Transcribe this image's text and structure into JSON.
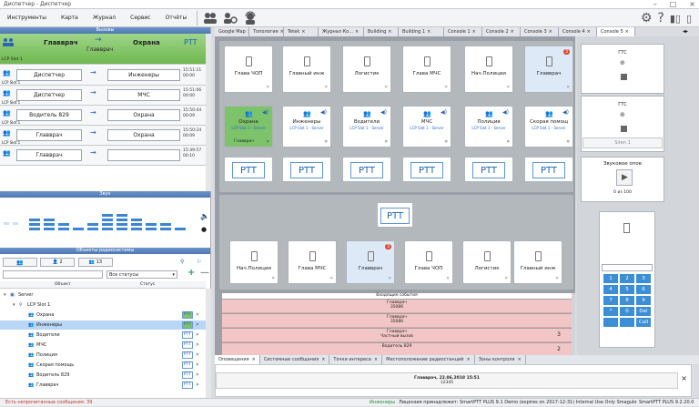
{
  "window": {
    "title": "Диспетчер - Диспетчер",
    "controls": [
      "–",
      "□",
      "×"
    ]
  },
  "menu": {
    "items": [
      "Инструменты",
      "Карта",
      "Журнал",
      "Сервис",
      "Отчёты"
    ]
  },
  "toolbar": {
    "icons": [
      "people-icon",
      "people-settings-icon",
      "operator-icon"
    ],
    "right_icons": [
      "gear-icon",
      "help-icon",
      "layout-icon",
      "panel-icon"
    ]
  },
  "calls_panel": {
    "title": "Вызовы",
    "active": {
      "from": "Главврач",
      "to": "Охрана",
      "via": "Главврач",
      "ptt": "PTT",
      "slot": "LCP Slot 1"
    },
    "rows": [
      {
        "from": "Диспетчер",
        "to": "Инженеры",
        "time": "15:51:11",
        "dur": "00:00",
        "slot": "LCP Slot 1"
      },
      {
        "from": "Диспетчер",
        "to": "МЧС",
        "time": "15:51:06",
        "dur": "00:00",
        "slot": "LCP Slot 1"
      },
      {
        "from": "Водитель 829",
        "to": "Охрана",
        "time": "15:50:44",
        "dur": "00:09",
        "slot": "LCP Slot 1"
      },
      {
        "from": "Главврач",
        "to": "Охрана",
        "time": "15:50:24",
        "dur": "00:09",
        "slot": "LCP Slot 1"
      },
      {
        "from": "Главврач",
        "to": "",
        "time": "15:49:57",
        "dur": "00:10",
        "slot": ""
      }
    ]
  },
  "sound_panel": {
    "title": "Звук"
  },
  "objects_panel": {
    "title": "Объекты радиосистемы",
    "tabs": [
      "",
      "2",
      "13"
    ],
    "filter": "Все статусы",
    "col_object": "Объект",
    "col_status": "Статус",
    "tree": [
      {
        "label": "Server",
        "indent": 0,
        "ptt": false
      },
      {
        "label": "LCP Slot 1",
        "indent": 1,
        "ptt": false
      },
      {
        "label": "Охрана",
        "indent": 2,
        "ptt": true,
        "hl": false,
        "green": true
      },
      {
        "label": "Инженеры",
        "indent": 2,
        "ptt": true,
        "hl": true,
        "green": true
      },
      {
        "label": "Водители",
        "indent": 2,
        "ptt": true,
        "hl": false,
        "green": false
      },
      {
        "label": "МЧС",
        "indent": 2,
        "ptt": true,
        "hl": false,
        "green": false
      },
      {
        "label": "Полиция",
        "indent": 2,
        "ptt": true,
        "hl": false,
        "green": false
      },
      {
        "label": "Скорая помощь",
        "indent": 2,
        "ptt": true,
        "hl": false,
        "green": false
      },
      {
        "label": "Водитель 829",
        "indent": 2,
        "ptt": true,
        "hl": false,
        "green": false
      },
      {
        "label": "Главврач",
        "indent": 2,
        "ptt": true,
        "hl": false,
        "green": false
      }
    ],
    "ptt_label": "PTT"
  },
  "tabs": [
    "Google Map",
    "Топология",
    "Tetek",
    "Журнал Ко...",
    "Building",
    "Building 1",
    "Console 1",
    "Console 2",
    "Console 3",
    "Console 4",
    "Console 5"
  ],
  "console": {
    "top_cards": [
      "Глава ЧОП",
      "Главный инж",
      "Логистик",
      "Глава МЧС",
      "Нач.Полиции",
      "Главврач"
    ],
    "badge": "3",
    "groups": [
      {
        "label": "Охрана",
        "sub": "LCP Slot 1 - Server",
        "active": true,
        "foot": "Главврач"
      },
      {
        "label": "Инженеры",
        "sub": "LCP Slot 1 - Server"
      },
      {
        "label": "Водители",
        "sub": "LCP Slot 1 - Server"
      },
      {
        "label": "МЧС",
        "sub": "LCP Slot 1 - Server"
      },
      {
        "label": "Полиция",
        "sub": "LCP Slot 1 - Server"
      },
      {
        "label": "Скорая помощ",
        "sub": "LCP Slot 1 - Server"
      }
    ],
    "ptt": "PTT",
    "bottom_cards": [
      "Нач.Полиции",
      "Глава МЧС",
      "Главврач",
      "Глава ЧОП",
      "Логистик",
      "Главный инж"
    ],
    "events_title": "Входящие события",
    "events": [
      {
        "a": "Главврач",
        "b": "35086",
        "n": ""
      },
      {
        "a": "Главврач",
        "b": "35086",
        "n": ""
      },
      {
        "a": "Главврач",
        "b": "Частный вызов",
        "n": "3"
      },
      {
        "a": "Водитель 829",
        "b": "",
        "n": "2"
      }
    ]
  },
  "right": {
    "gts1": "ГТС",
    "gts2": "ГТС",
    "siren": "Siren 1",
    "sound_title": "Звуковое опое",
    "sound_sub": "0 из 100",
    "keys": [
      "1",
      "2",
      "3",
      "4",
      "5",
      "6",
      "7",
      "8",
      "9",
      "*",
      "0",
      "Del",
      "",
      "",
      "Call"
    ]
  },
  "bottom_tabs": [
    "Оповещения",
    "Системные сообщения",
    "Точки интереса",
    "Местоположение радиостанций",
    "Зоны контроля"
  ],
  "alert": {
    "line1": "Главврач, 22.06.2018 15:51",
    "line2": "12345"
  },
  "status": {
    "left": "Есть непрочитанные сообщения: 39",
    "middle": "Инженеры",
    "license": "Лицензия принадлежит: SmartPTT PLUS 9.1 Demo (expires on 2017-12-31) Internal Use Only Smagulov",
    "version": "SmartPTT PLUS 9.2.20.0"
  }
}
